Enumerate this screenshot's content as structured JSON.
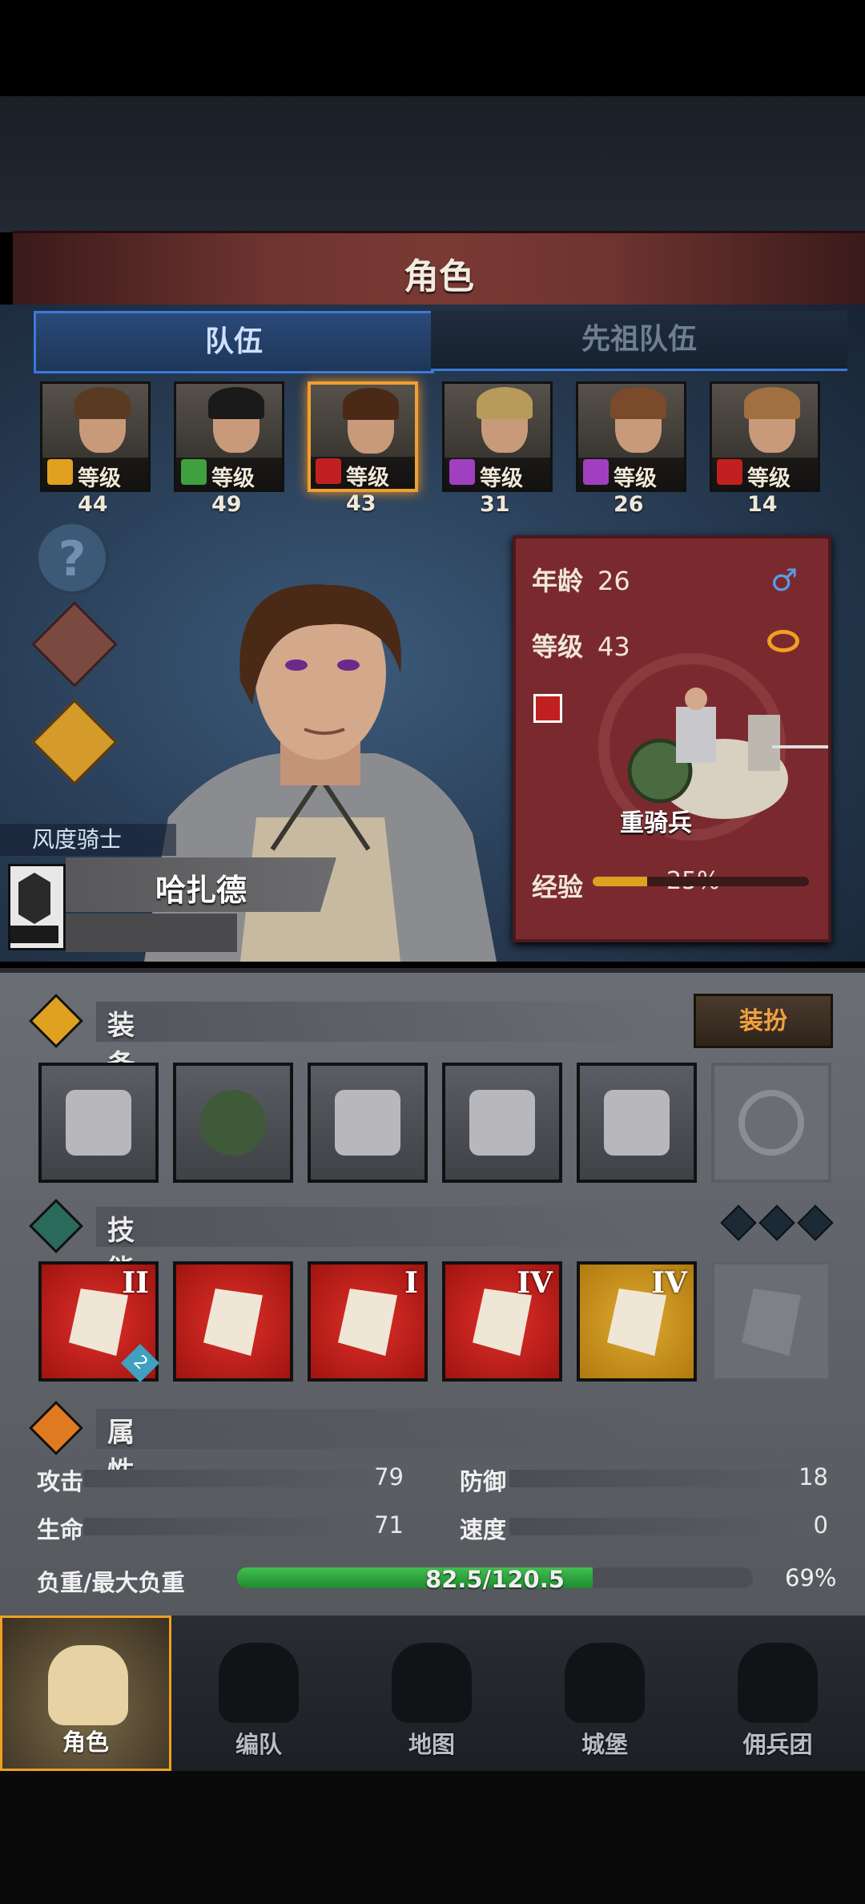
{
  "title": "角色",
  "tabs": [
    {
      "label": "队伍",
      "active": true
    },
    {
      "label": "先祖队伍",
      "active": false
    }
  ],
  "roster": [
    {
      "level": "等级44",
      "class_icon": "shield-icon",
      "class_color": "#e0a020",
      "hair": "#5a3a22",
      "selected": false
    },
    {
      "level": "等级49",
      "class_icon": "bow-icon",
      "class_color": "#40a040",
      "hair": "#1a1a1a",
      "selected": false
    },
    {
      "level": "等级43",
      "class_icon": "horse-icon",
      "class_color": "#c02020",
      "hair": "#4a2a16",
      "selected": true
    },
    {
      "level": "等级31",
      "class_icon": "staff-icon",
      "class_color": "#a040c0",
      "hair": "#b89a5a",
      "selected": false
    },
    {
      "level": "等级26",
      "class_icon": "staff-icon",
      "class_color": "#a040c0",
      "hair": "#7a4a2a",
      "selected": false
    },
    {
      "level": "等级14",
      "class_icon": "horse-icon",
      "class_color": "#c02020",
      "hair": "#a07040",
      "selected": false
    }
  ],
  "side_buttons": {
    "help": "?"
  },
  "info_card": {
    "age_label": "年龄",
    "age_value": "26",
    "level_label": "等级",
    "level_value": "43",
    "unit_label": "重骑兵",
    "exp_label": "经验",
    "exp_value": "25%",
    "exp_fraction": 0.25
  },
  "hero": {
    "class_title": "风度骑士",
    "name": "哈扎德"
  },
  "equipment": {
    "label": "装备",
    "dress_button": "装扮",
    "slots": [
      "spear-icon",
      "round-shield-icon",
      "helmet-icon",
      "plate-armor-icon",
      "greaves-icon",
      "ring-icon"
    ]
  },
  "skills": {
    "label": "技能",
    "items": [
      {
        "icon": "horse-charge-icon",
        "rank": "II",
        "badge": "2"
      },
      {
        "icon": "fist-strike-icon",
        "rank": ""
      },
      {
        "icon": "sword-cursor-icon",
        "rank": "I"
      },
      {
        "icon": "sword-icon",
        "rank": "IV"
      },
      {
        "icon": "shield-rune-icon",
        "rank": "IV"
      },
      {
        "icon": "lock-icon",
        "rank": ""
      }
    ]
  },
  "attributes": {
    "label": "属性",
    "attack_label": "攻击",
    "attack_value": "79",
    "defense_label": "防御",
    "defense_value": "18",
    "hp_label": "生命",
    "hp_value": "71",
    "speed_label": "速度",
    "speed_value": "0",
    "weight_label": "负重/最大负重",
    "weight_value": "82.5/120.5",
    "weight_percent": "69%",
    "weight_fraction": 0.69
  },
  "nav": [
    {
      "label": "角色",
      "icon": "knight-icon",
      "active": true
    },
    {
      "label": "编队",
      "icon": "helmet-party-icon",
      "active": false
    },
    {
      "label": "地图",
      "icon": "compass-map-icon",
      "active": false
    },
    {
      "label": "城堡",
      "icon": "castle-icon",
      "active": false
    },
    {
      "label": "佣兵团",
      "icon": "mercenary-banner-icon",
      "active": false
    }
  ],
  "colors": {
    "accent": "#f0a020",
    "tab_blue": "#3a7ad8",
    "exp": "#e0a020",
    "weight": "#30b040"
  }
}
